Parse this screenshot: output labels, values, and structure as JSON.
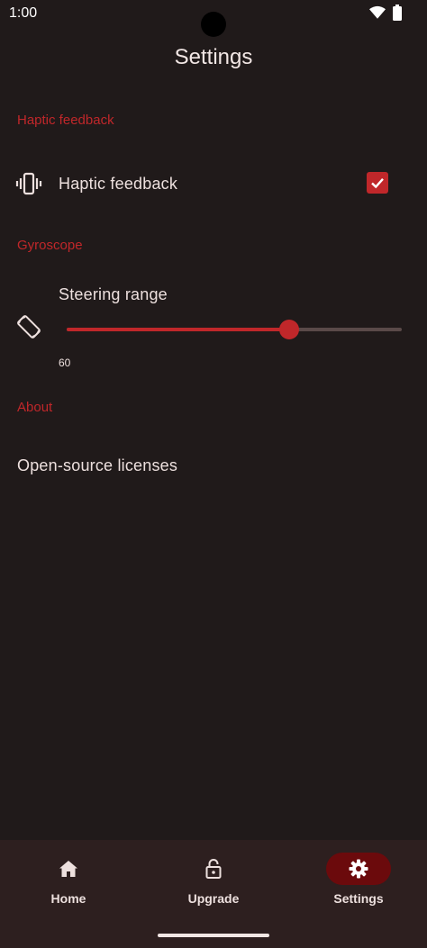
{
  "status_bar": {
    "time": "1:00"
  },
  "header": {
    "title": "Settings"
  },
  "sections": {
    "haptic": {
      "header": "Haptic feedback",
      "item_label": "Haptic feedback",
      "checked": true
    },
    "gyroscope": {
      "header": "Gyroscope",
      "item_label": "Steering range",
      "value": "60",
      "fill_fraction": 0.665
    },
    "about": {
      "header": "About",
      "item_label": "Open-source licenses"
    }
  },
  "bottom_nav": {
    "items": [
      {
        "label": "Home",
        "icon": "home-icon",
        "active": false
      },
      {
        "label": "Upgrade",
        "icon": "lock-icon",
        "active": false
      },
      {
        "label": "Settings",
        "icon": "gear-icon",
        "active": true
      }
    ]
  },
  "colors": {
    "background": "#201a1a",
    "accent": "#c0272a",
    "nav_background": "#2d1f1f",
    "nav_active_pill": "#6b0a0c"
  }
}
